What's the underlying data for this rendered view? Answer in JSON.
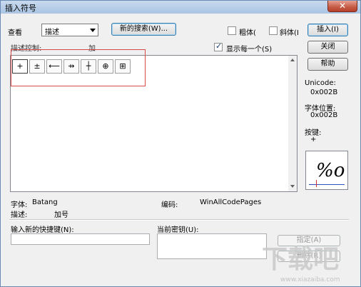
{
  "window": {
    "title": "插入符号",
    "close_glyph": "✕"
  },
  "toolbar": {
    "view_label": "查看",
    "view_value": "描述",
    "new_search_label": "新的搜索(W)...",
    "bold_label": "粗体(",
    "italic_label": "斜体(I",
    "insert_label": "插入(I)"
  },
  "description_control": {
    "label": "描述控制:",
    "value": "加"
  },
  "show_each_label": "显示每一个(S)",
  "symbols": [
    "+",
    "±",
    "⟵",
    "⇸",
    "┼",
    "⊕",
    "⊞"
  ],
  "buttons": {
    "close_label": "关闭",
    "help_label": "帮助",
    "assign_label": "指定(A)",
    "remove_label": "删除(R)"
  },
  "info": {
    "unicode_label": "Unicode:",
    "unicode_value": "0x002B",
    "charpos_label": "字体位置:",
    "charpos_value": "0x002B",
    "key_label": "按键:",
    "key_value": "+",
    "preview_glyph": "%o"
  },
  "font_info": {
    "font_label": "字体:",
    "font_value": "Batang",
    "desc_label": "描述:",
    "desc_value": "加号",
    "encoding_label": "编码:",
    "encoding_value": "WinAllCodePages"
  },
  "shortcut": {
    "new_label": "输入新的快捷键(N):",
    "current_label": "当前密钥(U):"
  },
  "watermark": {
    "text": "下载吧",
    "url": "www.xiazaiba.com"
  }
}
